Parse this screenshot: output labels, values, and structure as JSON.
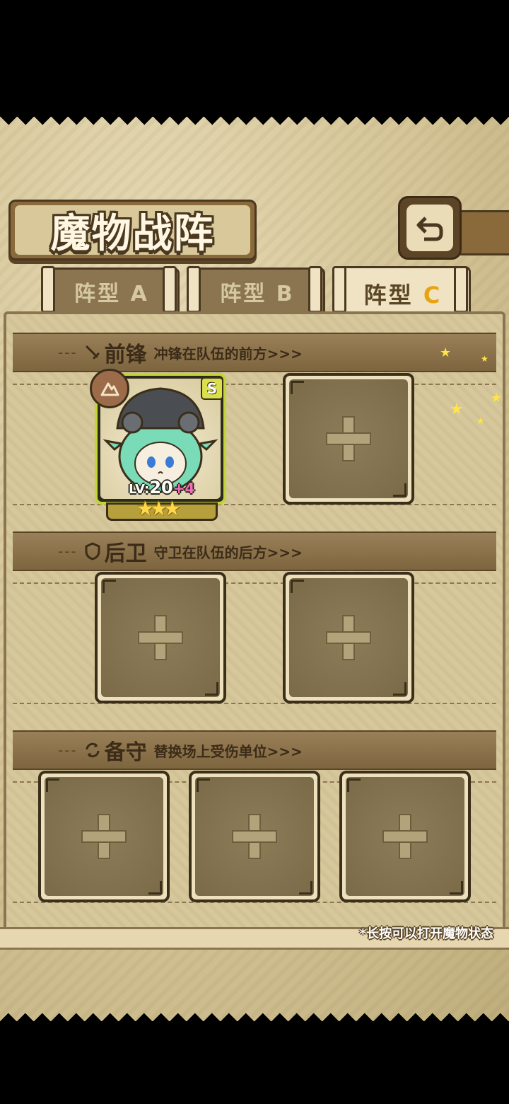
{
  "header": {
    "title": "魔物战阵",
    "back_icon": "back-arrow-icon"
  },
  "tabs": [
    {
      "label": "阵型",
      "suffix": "A",
      "active": false
    },
    {
      "label": "阵型",
      "suffix": "B",
      "active": false
    },
    {
      "label": "阵型",
      "suffix": "C",
      "active": true
    }
  ],
  "sections": {
    "front": {
      "dash": "---",
      "title": "前锋",
      "desc": "冲锋在队伍的前方>>>",
      "icon": "sword-icon"
    },
    "rear": {
      "dash": "---",
      "title": "后卫",
      "desc": "守卫在队伍的后方>>>",
      "icon": "shield-icon"
    },
    "reserve": {
      "dash": "---",
      "title": "备守",
      "desc": "替换场上受伤单位>>>",
      "icon": "swap-icon"
    }
  },
  "monster": {
    "level_prefix": "LV:",
    "level": "20",
    "bonus": "+4",
    "rarity": "S",
    "stars": "★★★",
    "element_icon": "earth-element-icon"
  },
  "hint": "*长按可以打开魔物状态",
  "colors": {
    "accent": "#e8a313",
    "rarity": "#d9e04a",
    "bonus": "#f06fb8",
    "panel": "#d7c89c"
  }
}
